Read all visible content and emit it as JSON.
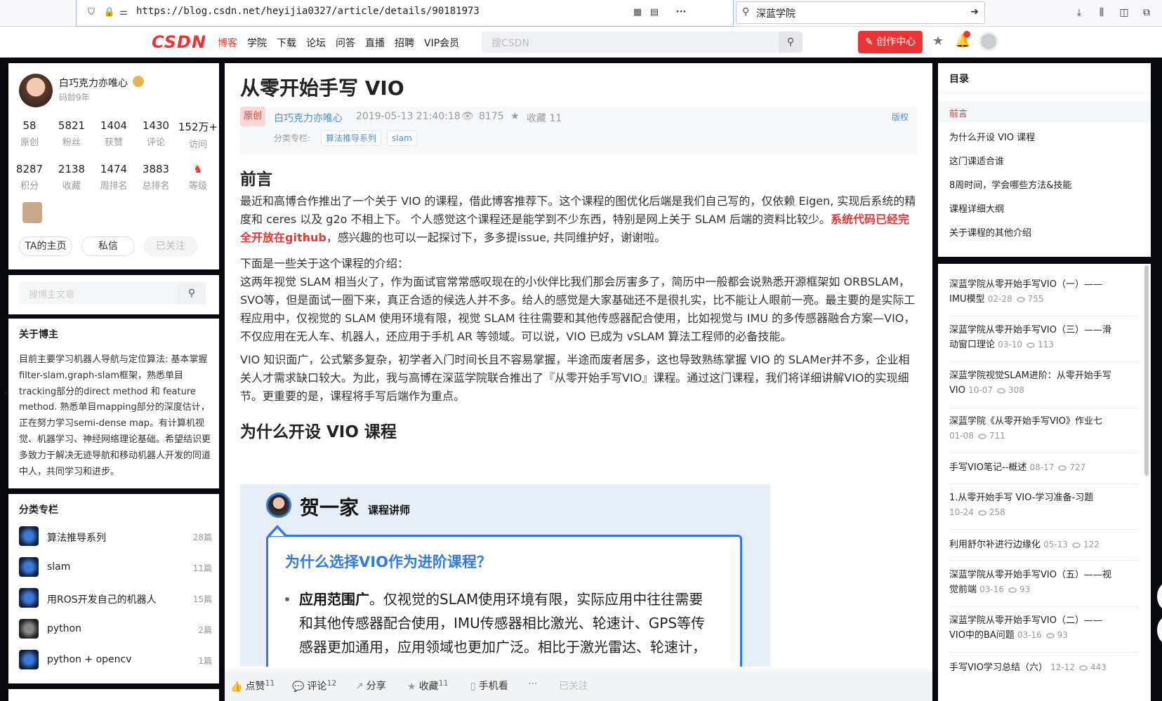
{
  "browser": {
    "url": "https://blog.csdn.net/heyijia0327/article/details/90181973",
    "search_value": "深蓝学院"
  },
  "toolbar": {
    "logo": "CSDN",
    "nav": [
      "博客",
      "学院",
      "下载",
      "论坛",
      "问答",
      "直播",
      "招聘",
      "VIP会员"
    ],
    "search_placeholder": "搜CSDN",
    "create_label": "创作中心"
  },
  "profile": {
    "name": "白巧克力亦唯心",
    "age": "码龄9年",
    "stats_row1": [
      {
        "n": "58",
        "l": "原创"
      },
      {
        "n": "5821",
        "l": "粉丝"
      },
      {
        "n": "1404",
        "l": "获赞"
      },
      {
        "n": "1430",
        "l": "评论"
      },
      {
        "n": "152万+",
        "l": "访问"
      }
    ],
    "stats_row2": [
      {
        "n": "8287",
        "l": "积分"
      },
      {
        "n": "2138",
        "l": "收藏"
      },
      {
        "n": "1474",
        "l": "周排名"
      },
      {
        "n": "3883",
        "l": "总排名"
      },
      {
        "n": "",
        "l": "等级"
      }
    ],
    "btn_home": "TA的主页",
    "btn_msg": "私信",
    "btn_follow": "已关注"
  },
  "blog_search": {
    "placeholder": "搜博主文章"
  },
  "about": {
    "title": "关于博主",
    "text": "目前主要学习机器人导航与定位算法: 基本掌握filter-slam,graph-slam框架，熟悉单目tracking部分的direct method 和 feature method. 熟悉单目mapping部分的深度估计，正在努力学习semi-dense map。有计算机视觉、机器学习、神经网络理论基础。希望结识更多致力于解决无迹导航和移动机器人开发的同道中人，共同学习和进步。"
  },
  "categories": {
    "title": "分类专栏",
    "items": [
      {
        "name": "算法推导系列",
        "count": "28篇"
      },
      {
        "name": "slam",
        "count": "11篇"
      },
      {
        "name": "用ROS开发自己的机器人",
        "count": "15篇"
      },
      {
        "name": "python",
        "count": "2篇"
      },
      {
        "name": "python + opencv",
        "count": "1篇"
      }
    ]
  },
  "article": {
    "title": "从零开始手写 VIO",
    "original": "原创",
    "author": "白巧克力亦唯心",
    "date": "2019-05-13 21:40:18",
    "views": "8175",
    "favorites": "收藏 11",
    "copyright": "版权",
    "column_label": "分类专栏:",
    "tags": [
      "算法推导系列",
      "slam"
    ],
    "h_intro": "前言",
    "p1": "最近和高博合作推出了一个关于 VIO 的课程，借此博客推荐下。这个课程的图优化后端是我们自己写的，仅依赖 Eigen, 实现后系统的精度和 ceres 以及 g2o 不相上下。 个人感觉这个课程还是能学到不少东西，特别是网上关于 SLAM 后端的资料比较少。",
    "p1_red": "系统代码已经完全开放在github",
    "p1_tail": "，感兴趣的也可以一起探讨下，多多提issue, 共同维护好，谢谢啦。",
    "p2a": "下面是一些关于这个课程的介绍：",
    "p2b": "这两年视觉 SLAM 相当火了，作为面试官常常感叹现在的小伙伴比我们那会厉害多了，简历中一般都会说熟悉开源框架如 ORBSLAM，SVO等，但是面试一圈下来，真正合适的候选人并不多。给人的感觉是大家基础还不是很扎实，比不能让人眼前一亮。最主要的是实际工程应用中，仅视觉的 SLAM 使用环境有限，视觉 SLAM 往往需要和其他传感器配合使用，比如视觉与 IMU 的多传感器融合方案—VIO，不仅应用在无人车、机器人，还应用于手机 AR 等领域。可以说，VIO 已成为 vSLAM 算法工程师的必备技能。",
    "p3": "VIO 知识面广，公式繁多复杂，初学者入门时间长且不容易掌握，半途而废者居多，这也导致熟练掌握 VIO 的 SLAMer并不多，企业相关人才需求缺口较大。为此，我与高博在深蓝学院联合推出了『从零开始手写VIO』课程。通过这门课程，我们将详细讲解VIO的实现细节。更重要的是，课程将手写后端作为重点。",
    "h_why": "为什么开设 VIO 课程",
    "banner": {
      "name": "贺一家",
      "role": "课程讲师",
      "question": "为什么选择VIO作为进阶课程？",
      "bullet_bold": "应用范围广",
      "bullet_text": "。仅视觉的SLAM使用环境有限，实际应用中往往需要和其他传感器配合使用，IMU传感器相比激光、轮速计、GPS等传感器更加通用，应用领域也更加广泛。相比于激光雷达、轮速计，"
    }
  },
  "bottom_bar": {
    "like": "点赞",
    "like_n": "11",
    "comment": "评论",
    "comment_n": "12",
    "share": "分享",
    "fav": "收藏",
    "fav_n": "11",
    "mobile": "手机看",
    "more": "···",
    "follow": "已关注"
  },
  "toc": {
    "title": "目录",
    "items": [
      "前言",
      "为什么开设 VIO 课程",
      "这门课适合谁",
      "8周时间，学会哪些方法&技能",
      "课程详细大纲",
      "关于课程的其他介绍"
    ]
  },
  "related": [
    {
      "l1": "深蓝学院从零开始手写VIO（一）——",
      "l2": "IMU模型",
      "date": "02-28",
      "views": "755"
    },
    {
      "l1": "深蓝学院从零开始手写VIO（三）——滑",
      "l2": "动窗口理论",
      "date": "03-10",
      "views": "113"
    },
    {
      "l1": "深蓝学院视觉SLAM进阶：从零开始手写",
      "l2": "VIO",
      "date": "10-07",
      "views": "308"
    },
    {
      "l1": "深蓝学院《从零开始手写VIO》作业七",
      "l2": "",
      "date": "01-08",
      "views": "711"
    },
    {
      "l1": "手写VIO笔记--概述",
      "l2": null,
      "date": "08-17",
      "views": "727"
    },
    {
      "l1": "1.从零开始手写 VIO-学习准备-习题",
      "l2": "",
      "date": "10-24",
      "views": "258"
    },
    {
      "l1": "利用舒尔补进行边缘化",
      "l2": null,
      "date": "05-13",
      "views": "122"
    },
    {
      "l1": "深蓝学院从零开始手写VIO（五）——视",
      "l2": "觉前端",
      "date": "03-16",
      "views": "93"
    },
    {
      "l1": "深蓝学院从零开始手写VIO（二）——",
      "l2": "VIO中的BA问题",
      "date": "03-16",
      "views": "93"
    },
    {
      "l1": "手写VIO学习总结（六）",
      "l2": null,
      "date": "12-12",
      "views": "443"
    }
  ]
}
